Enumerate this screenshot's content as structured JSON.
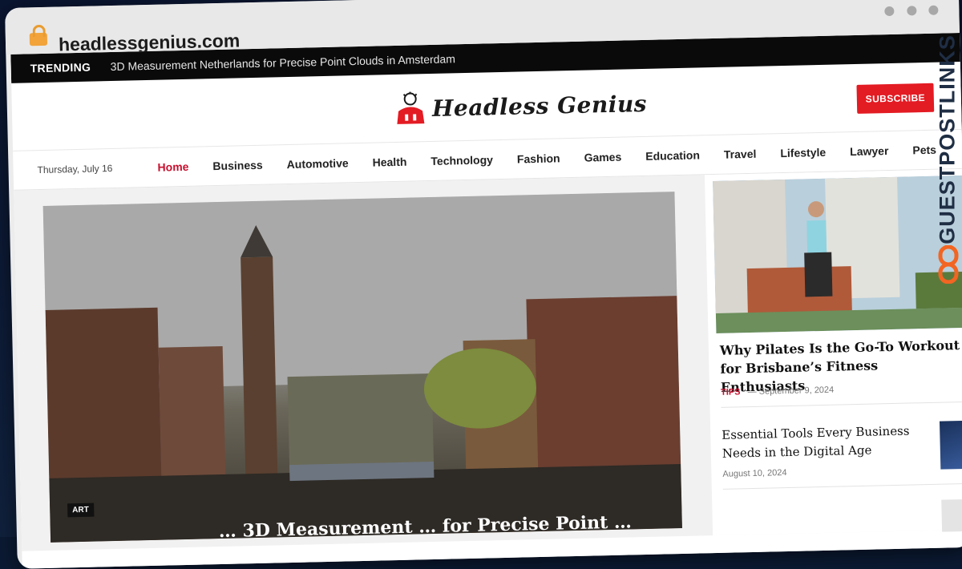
{
  "browser": {
    "url": "headlessgenius.com"
  },
  "trending": {
    "label": "TRENDING",
    "text": "3D Measurement Netherlands for Precise Point Clouds in Amsterdam"
  },
  "header": {
    "logo_text": "Headless Genius",
    "subscribe_label": "SUBSCRIBE"
  },
  "nav": {
    "date": "Thursday, July 16",
    "items": [
      "Home",
      "Business",
      "Automotive",
      "Health",
      "Technology",
      "Fashion",
      "Games",
      "Education",
      "Travel",
      "Lifestyle",
      "Lawyer",
      "Pets"
    ],
    "active": "Home"
  },
  "hero": {
    "category": "ART",
    "title": "… 3D Measurement … for Precise Point …"
  },
  "sidebar": {
    "featured": {
      "title": "Why Pilates Is the Go-To Workout for Brisbane’s Fitness Enthusiasts",
      "category": "TIPS",
      "date": "— September 9, 2024"
    },
    "second": {
      "title": "Essential Tools Every Business Needs in the Digital Age",
      "date": "August 10, 2024"
    }
  },
  "watermark": {
    "text": "GUESTPOSTLINKS"
  },
  "colors": {
    "accent": "#e31b23",
    "active_nav": "#c8102e",
    "trending_bg": "#0a0a0a"
  }
}
